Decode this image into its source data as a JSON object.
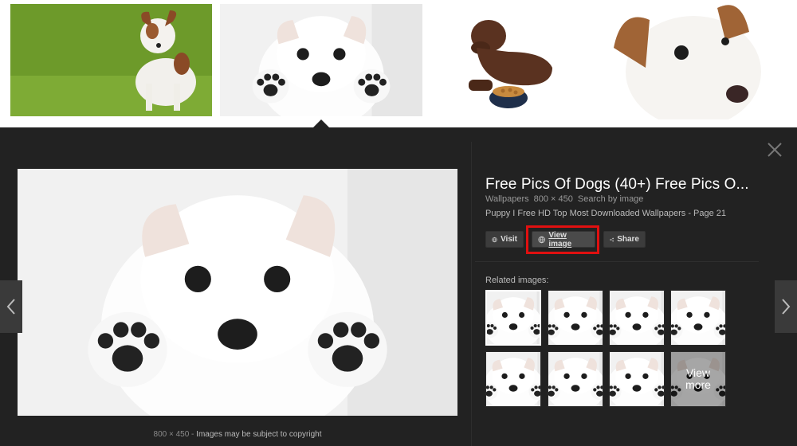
{
  "panel": {
    "title": "Free Pics Of Dogs (40+) Free Pics O...",
    "source": "Wallpapers",
    "dimensions": "800 × 450",
    "search_by_image": "Search by image",
    "description": "Puppy I Free HD Top Most Downloaded Wallpapers - Page 21",
    "buttons": {
      "visit": "Visit",
      "view_image": "View image",
      "share": "Share"
    },
    "related_label": "Related images:",
    "view_more_line1": "View",
    "view_more_line2": "more",
    "caption_size": "800 × 450",
    "caption_sep": " - ",
    "caption_text": "Images may be subject to copyright"
  },
  "icons": {
    "close": "close-icon",
    "prev": "chevron-left-icon",
    "next": "chevron-right-icon",
    "visit": "globe-icon",
    "view_image": "globe-icon",
    "share": "share-icon"
  },
  "colors": {
    "panel_bg": "#222222",
    "button_bg": "#3c3c3c",
    "highlight": "#e01010",
    "title": "#ffffff"
  }
}
